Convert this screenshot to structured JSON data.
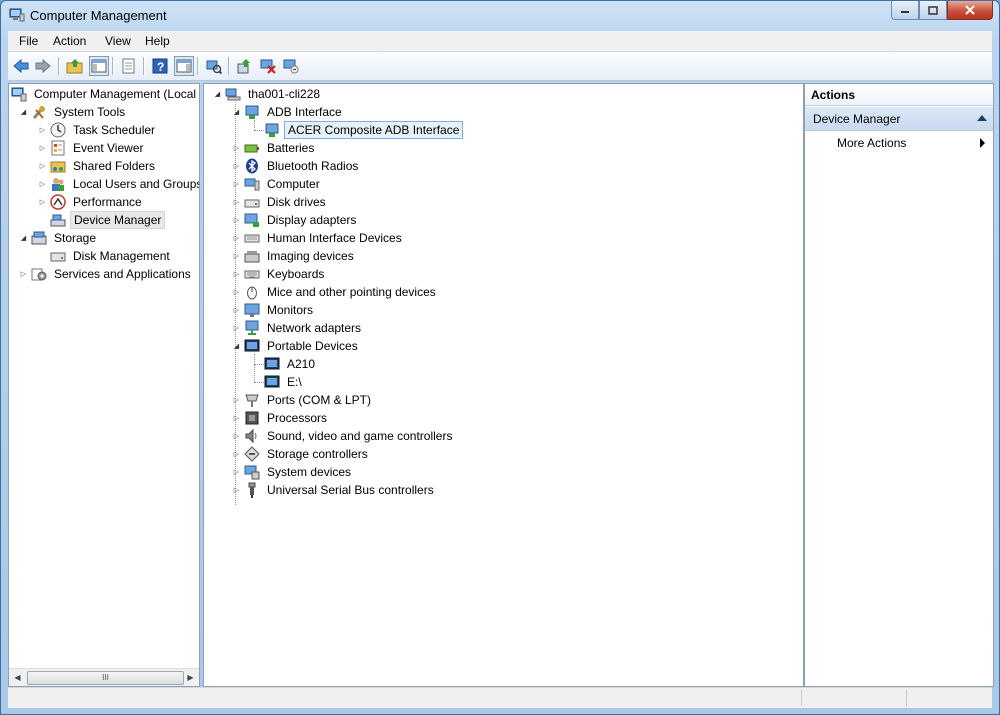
{
  "window": {
    "title": "Computer Management"
  },
  "menu": {
    "file": "File",
    "action": "Action",
    "view": "View",
    "help": "Help"
  },
  "left_tree": {
    "root": "Computer Management (Local",
    "system_tools": "System Tools",
    "task_scheduler": "Task Scheduler",
    "event_viewer": "Event Viewer",
    "shared_folders": "Shared Folders",
    "local_users": "Local Users and Groups",
    "performance": "Performance",
    "device_manager": "Device Manager",
    "storage": "Storage",
    "disk_management": "Disk Management",
    "services": "Services and Applications"
  },
  "device_tree": {
    "root": "tha001-cli228",
    "categories": [
      "ADB Interface",
      "ACER Composite ADB Interface",
      "Batteries",
      "Bluetooth Radios",
      "Computer",
      "Disk drives",
      "Display adapters",
      "Human Interface Devices",
      "Imaging devices",
      "Keyboards",
      "Mice and other pointing devices",
      "Monitors",
      "Network adapters",
      "Portable Devices",
      "A210",
      "E:\\",
      "Ports (COM & LPT)",
      "Processors",
      "Sound, video and game controllers",
      "Storage controllers",
      "System devices",
      "Universal Serial Bus controllers"
    ]
  },
  "actions": {
    "header": "Actions",
    "section": "Device Manager",
    "more": "More Actions"
  },
  "icons": {
    "back": "back-arrow-icon",
    "forward": "forward-arrow-icon",
    "folder_up": "up-folder-icon",
    "console_tree": "show-hide-console-tree-icon",
    "export": "export-list-icon",
    "help": "help-icon",
    "action_pane": "show-hide-action-pane-icon",
    "scan": "scan-hardware-icon",
    "update_driver": "update-driver-icon",
    "disable": "disable-device-icon",
    "uninstall": "uninstall-device-icon"
  },
  "scrollbar_grip": "III"
}
